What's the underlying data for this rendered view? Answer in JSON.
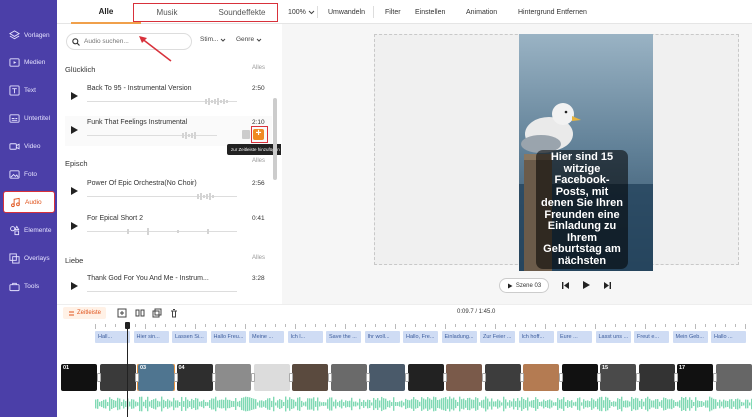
{
  "sidebar": {
    "items": [
      {
        "label": "Vorlagen",
        "icon": "template-icon"
      },
      {
        "label": "Medien",
        "icon": "media-icon"
      },
      {
        "label": "Text",
        "icon": "text-icon"
      },
      {
        "label": "Untertitel",
        "icon": "subtitle-icon"
      },
      {
        "label": "Video",
        "icon": "video-icon"
      },
      {
        "label": "Foto",
        "icon": "photo-icon"
      },
      {
        "label": "Audio",
        "icon": "music-icon",
        "active": true
      },
      {
        "label": "Elemente",
        "icon": "elements-icon"
      },
      {
        "label": "Overlays",
        "icon": "overlays-icon"
      },
      {
        "label": "Tools",
        "icon": "tools-icon"
      }
    ]
  },
  "tabs": {
    "all": "Alle",
    "music": "Musik",
    "sfx": "Soundeffekte"
  },
  "toolbar": {
    "zoom": "100%",
    "convert": "Umwandeln",
    "filter": "Filter",
    "settings": "Einstellen",
    "animation": "Animation",
    "remove_bg": "Hintergrund Entfernen"
  },
  "search": {
    "placeholder": "Audio suchen...",
    "mood": "Stim...",
    "genre": "Genre"
  },
  "sections": [
    {
      "title": "Glücklich",
      "all": "Alles",
      "tracks": [
        {
          "name": "Back To 95 - Instrumental Version",
          "duration": "2:50"
        },
        {
          "name": "Funk That Feelings Instrumental",
          "duration": "2:10"
        }
      ]
    },
    {
      "title": "Episch",
      "all": "Alles",
      "tracks": [
        {
          "name": "Power Of Epic Orchestra(No Choir)",
          "duration": "2:56"
        },
        {
          "name": "For Epical Short 2",
          "duration": "0:41"
        }
      ]
    },
    {
      "title": "Liebe",
      "all": "Alles",
      "tracks": [
        {
          "name": "Thank God For You And Me - Instrum...",
          "duration": "3:28"
        }
      ]
    }
  ],
  "tooltip": "zur Zeitleiste hinzufügen",
  "preview": {
    "caption": "Hier sind 15 witzige Facebook-Posts, mit denen Sie Ihren Freunden eine Einladung zu Ihrem Geburtstag am nächsten",
    "scene": "Szene 03"
  },
  "timeline": {
    "label": "Zeitleiste",
    "time": "0:09.7 / 1:45.0",
    "captions": [
      "Hall...",
      "Hier sin...",
      "Lassen Si...",
      "Hallo Freu...",
      "Meine ...",
      "Ich l...",
      "Save the ...",
      "Ihr woll...",
      "Hallo, Fre...",
      "Einladung...",
      "Zur Feier ...",
      "Ich hoff...",
      "Eure ...",
      "Lasst uns ...",
      "Freut e...",
      "Mein Geb...",
      "Hallo ..."
    ],
    "clips": [
      "01",
      "",
      "03",
      "04",
      "",
      "",
      "",
      "",
      "",
      "",
      "",
      "",
      "",
      "",
      "15",
      "",
      "17",
      ""
    ]
  },
  "colors": {
    "sidebar": "#4b3fa8",
    "accent": "#f08a24",
    "highlight": "#d8313b",
    "caption_chip": "#cfdcf4",
    "wave": "#7fd9b4"
  }
}
